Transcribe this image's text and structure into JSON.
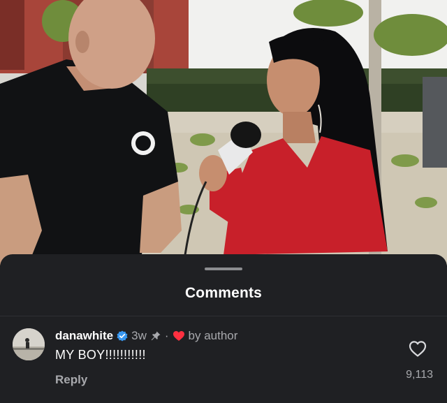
{
  "sheet": {
    "title": "Comments"
  },
  "comment": {
    "username": "danawhite",
    "verified_icon": "verified-badge-icon",
    "age": "3w",
    "pin_icon": "pin-icon",
    "separator": "·",
    "liked_by_author_icon": "heart-filled-icon",
    "liked_by_author_label": "by author",
    "text": "MY BOY!!!!!!!!!!!",
    "reply_label": "Reply",
    "like_icon": "heart-outline-icon",
    "like_count": "9,113"
  },
  "colors": {
    "sheet_background": "#1f2023",
    "secondary_text": "#a8a9ad",
    "verified_blue": "#3897f0",
    "heart_red": "#ff3040",
    "dress_red": "#c8202a"
  }
}
